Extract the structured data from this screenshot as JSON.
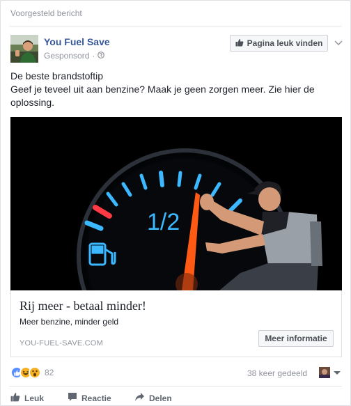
{
  "post": {
    "suggested_label": "Voorgesteld bericht",
    "page_name": "You Fuel Save",
    "sponsored_label": "Gesponsord",
    "sponsored_separator": "·",
    "like_page_label": "Pagina leuk vinden",
    "text_line1": "De beste brandstoftip",
    "text_line2": "Geef je teveel uit aan benzine? Maak je geen zorgen meer. Zie hier de oplossing."
  },
  "ad": {
    "gauge_half_label": "1/2",
    "headline": "Rij meer - betaal minder!",
    "description": "Meer benzine, minder geld",
    "domain": "YOU-FUEL-SAVE.COM",
    "cta_label": "Meer informatie"
  },
  "footer": {
    "reaction_count": "82",
    "shares": "38 keer gedeeld",
    "actions": [
      {
        "label": "Leuk",
        "icon": "thumbs-up-icon"
      },
      {
        "label": "Reactie",
        "icon": "comment-icon"
      },
      {
        "label": "Delen",
        "icon": "share-icon"
      }
    ]
  },
  "colors": {
    "link_blue": "#365899",
    "meta_gray": "#90949c",
    "like_blue": "#5890ff",
    "haha_yellow": "#f7b125",
    "needle_orange": "#ff5a14",
    "gauge_cyan": "#2fa8ff"
  }
}
